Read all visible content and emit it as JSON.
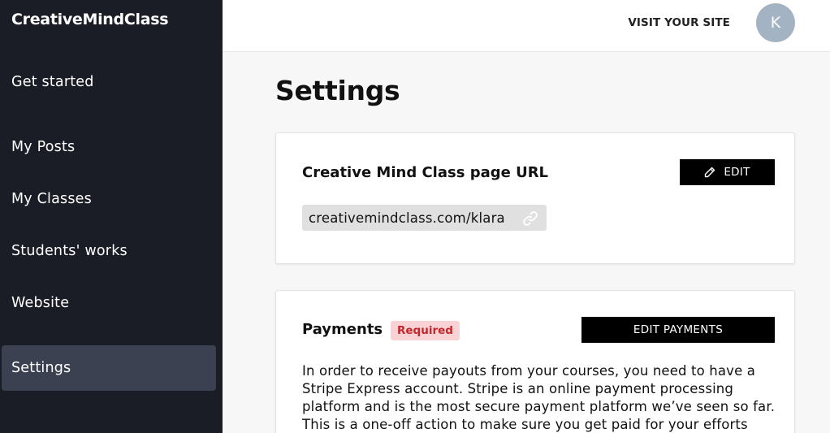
{
  "sidebar": {
    "brand": "CreativeMindClass",
    "items": [
      {
        "label": "Get started",
        "active": false
      },
      {
        "label": "My Posts",
        "active": false
      },
      {
        "label": "My Classes",
        "active": false
      },
      {
        "label": "Students' works",
        "active": false
      },
      {
        "label": "Website",
        "active": false
      },
      {
        "label": "Settings",
        "active": true
      }
    ]
  },
  "header": {
    "visit_label": "VISIT YOUR SITE",
    "avatar_initial": "K"
  },
  "main": {
    "title": "Settings",
    "url_card": {
      "heading": "Creative Mind Class page URL",
      "edit_label": "EDIT",
      "url": "creativemindclass.com/klara"
    },
    "payments_card": {
      "heading": "Payments",
      "badge": "Required",
      "edit_label": "EDIT PAYMENTS",
      "description": "In order to receive payouts from your courses, you need to have a Stripe Express account. Stripe is an online payment processing platform and is the most secure payment platform we’ve seen so far. This is a one-off action to make sure you get paid for your efforts"
    }
  },
  "colors": {
    "sidebar_bg": "#1a1d26",
    "sidebar_active": "#3b4150",
    "badge_bg": "#f8d2d4",
    "badge_text": "#c2282e",
    "avatar_bg": "#a3b3c3"
  }
}
